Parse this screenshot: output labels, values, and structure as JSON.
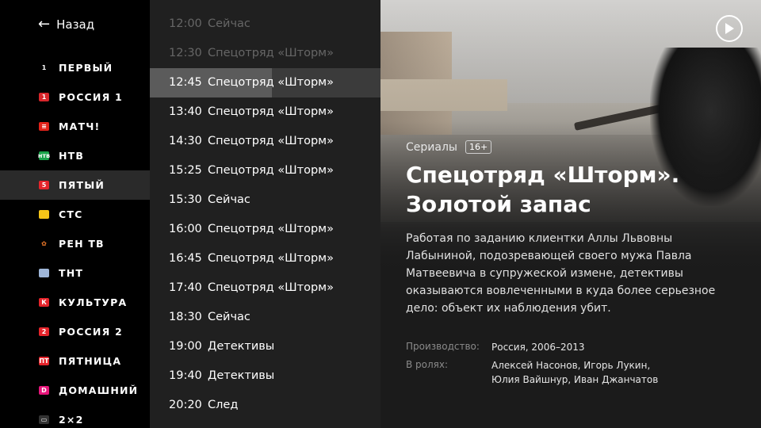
{
  "nav": {
    "back_arrow": "←",
    "back_label": "Назад"
  },
  "channels": [
    {
      "name": "ПЕРВЫЙ",
      "logo": "1",
      "logo_bg": "#000000",
      "logo_color": "#ffffff"
    },
    {
      "name": "РОССИЯ 1",
      "logo": "1",
      "logo_bg": "#d8262b",
      "logo_color": "#ffffff"
    },
    {
      "name": "МАТЧ!",
      "logo": "≡",
      "logo_bg": "#e2231a",
      "logo_color": "#ffffff"
    },
    {
      "name": "НТВ",
      "logo": "нтв",
      "logo_bg": "#1aa34a",
      "logo_color": "#ffffff"
    },
    {
      "name": "ПЯТЫЙ",
      "logo": "5",
      "logo_bg": "#e5242b",
      "logo_color": "#ffffff",
      "active": true
    },
    {
      "name": "СТС",
      "logo": "",
      "logo_bg": "#f5c518",
      "logo_color": "#000000"
    },
    {
      "name": "РЕН ТВ",
      "logo": "✿",
      "logo_bg": "#000000",
      "logo_color": "#f07a2a"
    },
    {
      "name": "ТНТ",
      "logo": "",
      "logo_bg": "#9fb6d8",
      "logo_color": "#ffffff"
    },
    {
      "name": "КУЛЬТУРА",
      "logo": "К",
      "logo_bg": "#e5242b",
      "logo_color": "#ffffff"
    },
    {
      "name": "РОССИЯ 2",
      "logo": "2",
      "logo_bg": "#e5242b",
      "logo_color": "#ffffff"
    },
    {
      "name": "ПЯТНИЦА",
      "logo": "ПТ",
      "logo_bg": "#e5242b",
      "logo_color": "#ffffff"
    },
    {
      "name": "ДОМАШНИЙ",
      "logo": "D",
      "logo_bg": "#e6157a",
      "logo_color": "#ffffff"
    },
    {
      "name": "2×2",
      "logo": "▭",
      "logo_bg": "#333333",
      "logo_color": "#ffffff"
    }
  ],
  "schedule": [
    {
      "time": "12:00",
      "title": "Сейчас",
      "state": "past"
    },
    {
      "time": "12:30",
      "title": "Спецотряд «Шторм»",
      "state": "past"
    },
    {
      "time": "12:45",
      "title": "Спецотряд «Шторм»",
      "state": "active",
      "progress": 0.53
    },
    {
      "time": "13:40",
      "title": "Спецотряд «Шторм»"
    },
    {
      "time": "14:30",
      "title": "Спецотряд «Шторм»"
    },
    {
      "time": "15:25",
      "title": "Спецотряд «Шторм»"
    },
    {
      "time": "15:30",
      "title": "Сейчас"
    },
    {
      "time": "16:00",
      "title": "Спецотряд «Шторм»"
    },
    {
      "time": "16:45",
      "title": "Спецотряд «Шторм»"
    },
    {
      "time": "17:40",
      "title": "Спецотряд «Шторм»"
    },
    {
      "time": "18:30",
      "title": "Сейчас"
    },
    {
      "time": "19:00",
      "title": "Детективы"
    },
    {
      "time": "19:40",
      "title": "Детективы"
    },
    {
      "time": "20:20",
      "title": "След"
    }
  ],
  "details": {
    "genre": "Сериалы",
    "age_rating": "16+",
    "title_line1": "Спецотряд «Шторм».",
    "title_line2": "Золотой запас",
    "description": "Работая по заданию клиентки Аллы Львовны Лабыниной, подозревающей своего мужа Павла Матвеевича в супружеской измене, детективы оказываются вовлеченными в куда более серьезное дело: объект их наблюдения убит.",
    "production_label": "Производство:",
    "production_value": "Россия, 2006–2013",
    "cast_label": "В ролях:",
    "cast_line1": "Алексей Насонов, Игорь Лукин,",
    "cast_line2": "Юлия Вайшнур, Иван Джанчатов",
    "play_icon": "play-icon"
  }
}
